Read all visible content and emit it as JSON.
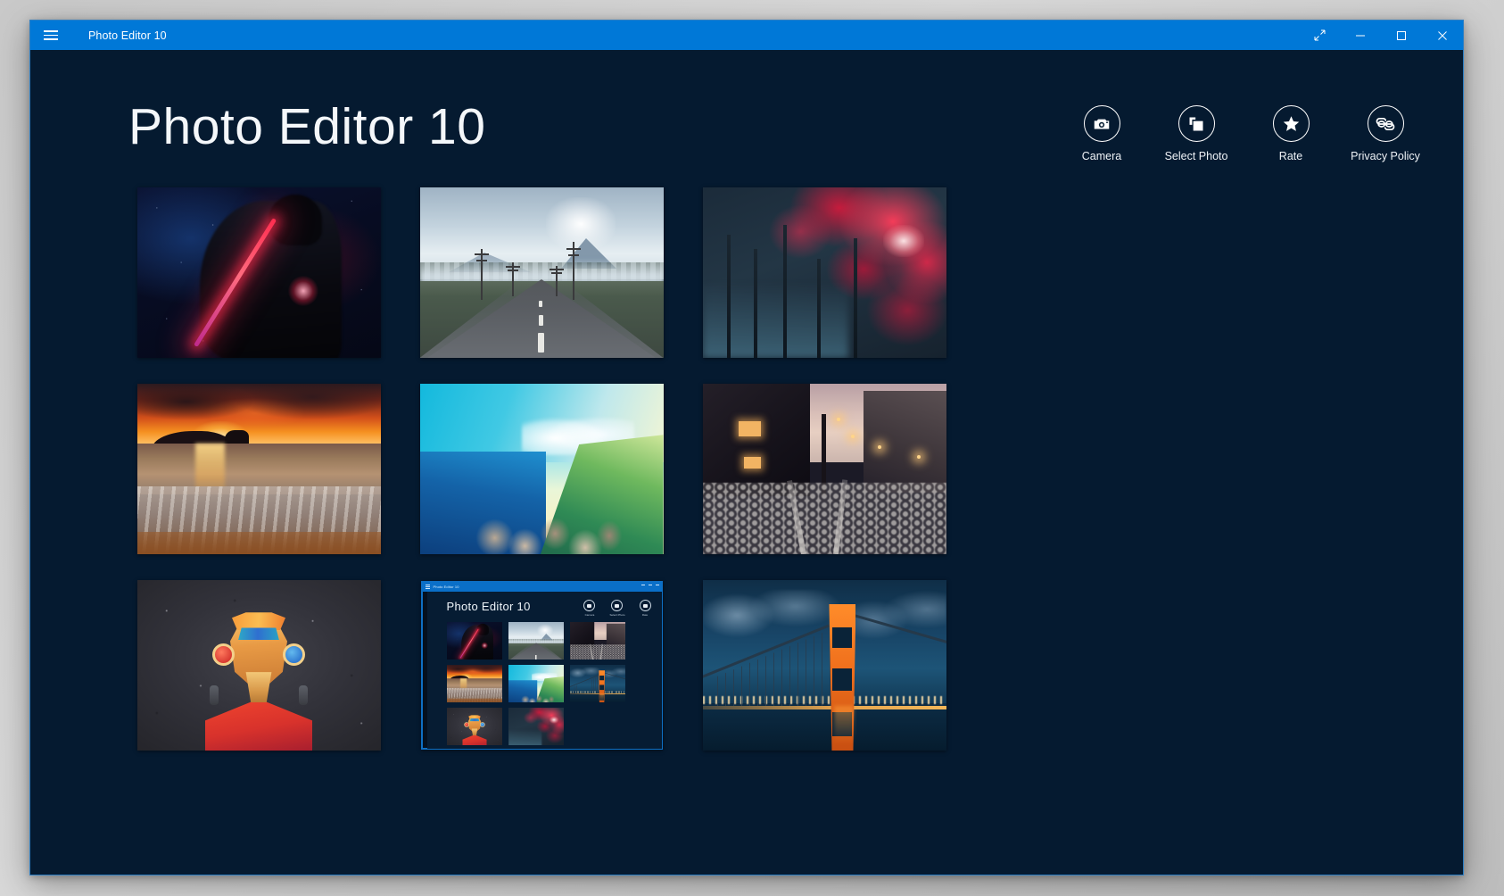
{
  "window": {
    "title": "Photo Editor 10",
    "menu_icon": "hamburger-menu-icon",
    "controls": {
      "restore_label": "Expand",
      "minimize_label": "Minimize",
      "maximize_label": "Maximize",
      "close_label": "Close"
    }
  },
  "header": {
    "title": "Photo Editor 10"
  },
  "toolbar": {
    "items": [
      {
        "label": "Camera",
        "icon": "camera-icon"
      },
      {
        "label": "Select Photo",
        "icon": "copy-photos-icon"
      },
      {
        "label": "Rate",
        "icon": "star-icon"
      },
      {
        "label": "Privacy Policy",
        "icon": "link-chain-icon"
      }
    ]
  },
  "gallery": {
    "columns": 3,
    "rows": 3,
    "items": [
      {
        "id": "photo-1",
        "caption": "Cloaked figure with red lightsaber in rain"
      },
      {
        "id": "photo-2",
        "caption": "Misty road with power poles and mountain"
      },
      {
        "id": "photo-3",
        "caption": "Crimson autumn forest canopy"
      },
      {
        "id": "photo-4",
        "caption": "Ocean sunset over beach surf"
      },
      {
        "id": "photo-5",
        "caption": "Green mountain ridge above blue sea"
      },
      {
        "id": "photo-6",
        "caption": "Cobblestone street at dusk with lamps"
      },
      {
        "id": "photo-7",
        "caption": "Low-poly masked hero in red jacket"
      },
      {
        "id": "photo-8",
        "caption": "Photo Editor 10 app screenshot"
      },
      {
        "id": "photo-9",
        "caption": "Golden Gate Bridge at night"
      }
    ]
  },
  "nested_app": {
    "titlebar_label": "Photo Editor 10",
    "header_title": "Photo Editor 10",
    "toolbar": [
      {
        "label": "Camera"
      },
      {
        "label": "Select Photo"
      },
      {
        "label": "Rate"
      }
    ]
  },
  "colors": {
    "titlebar": "#0078d7",
    "app_background": "#051a30",
    "desktop": "#d0d0d0",
    "accent_text": "#ffffff",
    "window_border": "#2d7fc4"
  }
}
